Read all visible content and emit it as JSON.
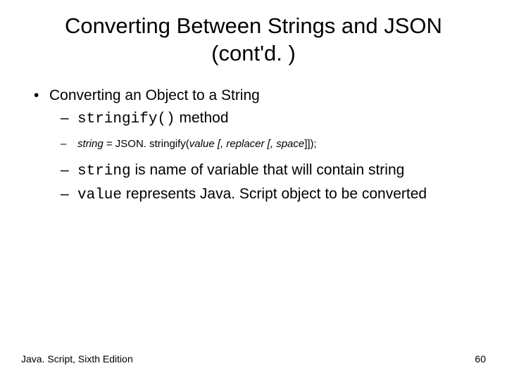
{
  "title": "Converting Between Strings and JSON (cont'd. )",
  "bullet1": "Converting an Object to a String",
  "sub1_code": "stringify()",
  "sub1_rest": " method",
  "code_line_pre": "string",
  "code_line_mid": " = JSON. stringify(",
  "code_line_args": "value [, replacer [, space",
  "code_line_end": "]]);",
  "sub2_code": "string",
  "sub2_rest": " is name of variable that will contain string",
  "sub3_code": "value",
  "sub3_rest": " represents Java. Script object to be converted",
  "footer_left": "Java. Script, Sixth Edition",
  "footer_right": "60",
  "dash": "–",
  "bullet": "•"
}
